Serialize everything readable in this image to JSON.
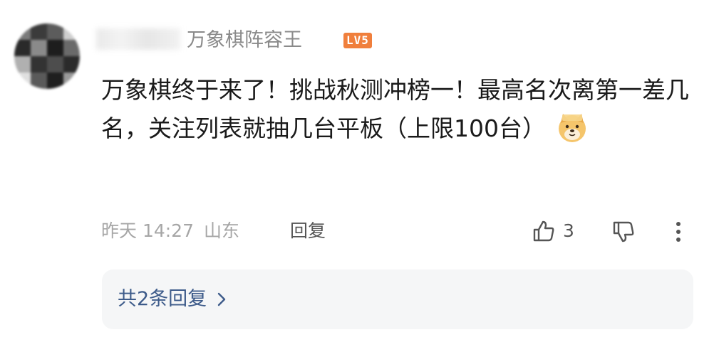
{
  "comment": {
    "author": {
      "name": "万象棋阵容王",
      "level_badge": "LV5",
      "level_badge_color": "#f07f3c",
      "avatar": "pixelated-avatar"
    },
    "text": "万象棋终于来了！挑战秋测冲榜一！最高名次离第一差几名，关注列表就抽几台平板（上限100台）",
    "emoji": "doge-emoji",
    "meta": {
      "time": "昨天 14:27",
      "location": "山东"
    },
    "actions": {
      "reply_label": "回复",
      "like_count": "3",
      "like_icon": "thumbs-up-icon",
      "dislike_icon": "thumbs-down-icon",
      "more_icon": "vertical-ellipsis-icon"
    },
    "replies": {
      "summary_label": "共2条回复",
      "chevron": "chevron-right-icon",
      "link_color": "#3d5b8a"
    }
  }
}
